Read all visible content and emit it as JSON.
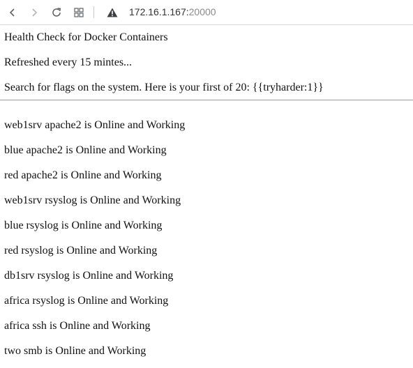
{
  "browser": {
    "url_host": "172.16.1.167:",
    "url_port": "20000"
  },
  "header": {
    "title": "Health Check for Docker Containers",
    "refresh": "Refreshed every 15 mintes...",
    "flag_hint": "Search for flags on the system. Here is your first of 20: {{tryharder:1}}"
  },
  "statuses": [
    "web1srv apache2 is Online and Working",
    "blue apache2 is Online and Working",
    "red apache2 is Online and Working",
    "web1srv rsyslog is Online and Working",
    "blue rsyslog is Online and Working",
    "red rsyslog is Online and Working",
    "db1srv rsyslog is Online and Working",
    "africa rsyslog is Online and Working",
    "africa ssh is Online and Working",
    "two smb is Online and Working"
  ]
}
